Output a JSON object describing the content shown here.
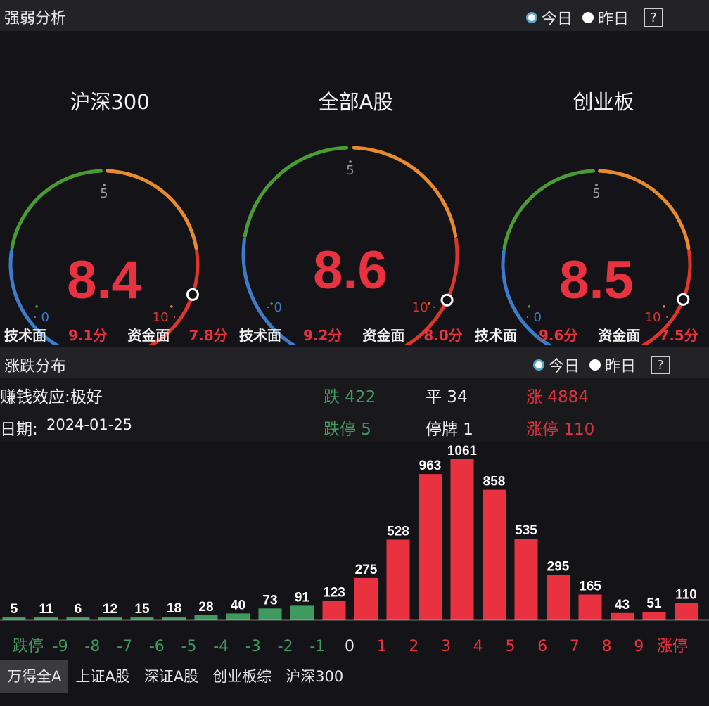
{
  "strength": {
    "title": "强弱分析",
    "radio_today": "今日",
    "radio_yesterday": "昨日",
    "help": "?"
  },
  "gauges": [
    {
      "name": "沪深300",
      "score": "8.4",
      "value": 8.4,
      "tech_label": "技术面",
      "tech": "9.1分",
      "fund_label": "资金面",
      "fund": "7.8分",
      "scale_mid": "5",
      "scale_min": "0",
      "scale_max": "10"
    },
    {
      "name": "全部A股",
      "score": "8.6",
      "value": 8.6,
      "tech_label": "技术面",
      "tech": "9.2分",
      "fund_label": "资金面",
      "fund": "8.0分",
      "scale_mid": "5",
      "scale_min": "0",
      "scale_max": "10"
    },
    {
      "name": "创业板",
      "score": "8.5",
      "value": 8.5,
      "tech_label": "技术面",
      "tech": "9.6分",
      "fund_label": "资金面",
      "fund": "7.5分",
      "scale_mid": "5",
      "scale_min": "0",
      "scale_max": "10"
    }
  ],
  "distribution": {
    "title": "涨跌分布",
    "radio_today": "今日",
    "radio_yesterday": "昨日",
    "help": "?",
    "effect": "赚钱效应:极好",
    "date_label": "日期:",
    "date": "2024-01-25",
    "down": "跌 422",
    "flat": "平 34",
    "up": "涨 4884",
    "limit_down": "跌停 5",
    "suspended": "停牌 1",
    "limit_up": "涨停 110"
  },
  "chart_data": {
    "type": "bar",
    "categories": [
      "跌停",
      "-9",
      "-8",
      "-7",
      "-6",
      "-5",
      "-4",
      "-3",
      "-2",
      "-1",
      "0",
      "1",
      "2",
      "3",
      "4",
      "5",
      "6",
      "7",
      "8",
      "9",
      "涨停"
    ],
    "values": [
      5,
      11,
      6,
      12,
      15,
      18,
      28,
      40,
      73,
      91,
      123,
      275,
      528,
      963,
      1061,
      858,
      535,
      295,
      165,
      43,
      51,
      110
    ],
    "colors": {
      "down": "#3f9a5f",
      "flat": "#e8e8e8",
      "up": "#e8323f"
    }
  },
  "tabs": [
    "万得全A",
    "上证A股",
    "深证A股",
    "创业板综",
    "沪深300"
  ],
  "colors": {
    "accent_red": "#e8323f",
    "accent_green": "#3f9a5f",
    "gauge_blue": "#3d7cc9",
    "gauge_green": "#4a9b32",
    "gauge_orange": "#e88a2e",
    "gauge_red": "#e0352b"
  }
}
